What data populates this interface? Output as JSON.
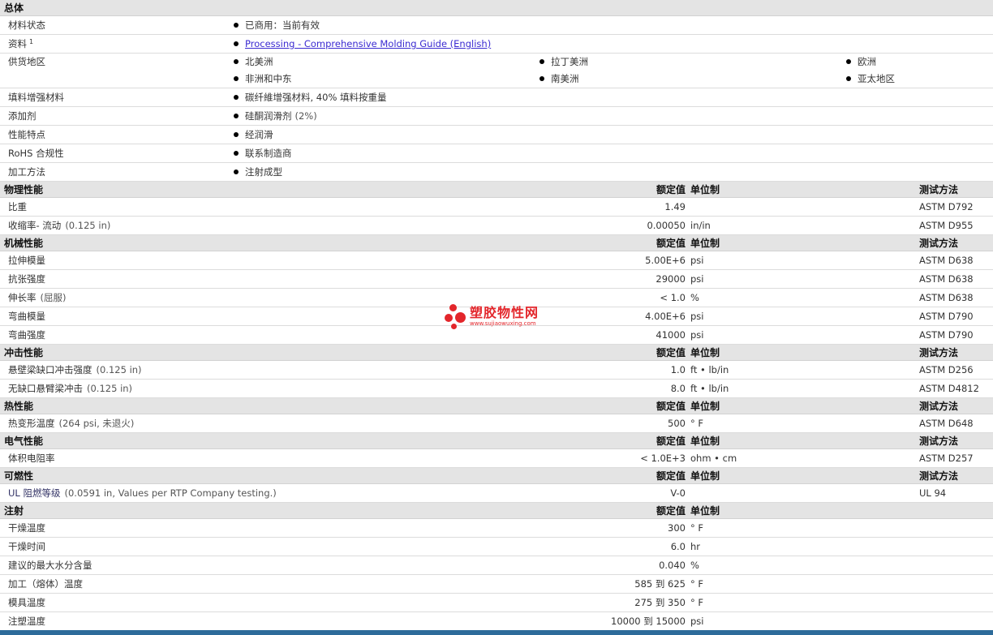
{
  "general": {
    "title": "总体",
    "rows": [
      {
        "label": "材料状态",
        "items": [
          "已商用：当前有效"
        ]
      },
      {
        "label": "资料",
        "sup": "1",
        "link": "Processing - Comprehensive Molding Guide (English)"
      },
      {
        "label": "供货地区",
        "regions": [
          [
            "北美洲",
            "拉丁美洲",
            "欧洲"
          ],
          [
            "非洲和中东",
            "南美洲",
            "亚太地区"
          ]
        ]
      },
      {
        "label": "填料增强材料",
        "items": [
          "碳纤維增强材料, 40% 填料按重量"
        ]
      },
      {
        "label": "添加剂",
        "item": "硅酮润滑剂",
        "note": "(2%)"
      },
      {
        "label": "性能特点",
        "items": [
          "经润滑"
        ]
      },
      {
        "label": "RoHS 合规性",
        "items": [
          "联系制造商"
        ]
      },
      {
        "label": "加工方法",
        "items": [
          "注射成型"
        ]
      }
    ]
  },
  "headers": {
    "value": "额定值",
    "unit": "单位制",
    "test": "测试方法"
  },
  "sections": [
    {
      "title": "物理性能",
      "rows": [
        {
          "label": "比重",
          "value": "1.49",
          "unit": "",
          "test": "ASTM D792"
        },
        {
          "label": "收缩率",
          "suffix": " - 流动",
          "note": "(0.125 in)",
          "value": "0.00050",
          "unit": "in/in",
          "test": "ASTM D955"
        }
      ]
    },
    {
      "title": "机械性能",
      "rows": [
        {
          "label": "拉伸模量",
          "value": "5.00E+6",
          "unit": "psi",
          "test": "ASTM D638"
        },
        {
          "label": "抗张强度",
          "value": "29000",
          "unit": "psi",
          "test": "ASTM D638"
        },
        {
          "label": "伸长率",
          "note": "(屈服)",
          "value": "< 1.0",
          "unit": "%",
          "test": "ASTM D638"
        },
        {
          "label": "弯曲模量",
          "value": "4.00E+6",
          "unit": "psi",
          "test": "ASTM D790"
        },
        {
          "label": "弯曲强度",
          "value": "41000",
          "unit": "psi",
          "test": "ASTM D790"
        }
      ]
    },
    {
      "title": "冲击性能",
      "rows": [
        {
          "label": "悬壁梁缺口冲击强度",
          "note": "(0.125 in)",
          "value": "1.0",
          "unit": "ft • lb/in",
          "test": "ASTM D256"
        },
        {
          "label": "无缺口悬臂梁冲击",
          "note": "(0.125 in)",
          "value": "8.0",
          "unit": "ft • lb/in",
          "test": "ASTM D4812"
        }
      ]
    },
    {
      "title": "热性能",
      "rows": [
        {
          "label": "热变形温度",
          "note": "(264 psi, 未退火)",
          "value": "500",
          "unit": "° F",
          "test": "ASTM D648"
        }
      ]
    },
    {
      "title": "电气性能",
      "rows": [
        {
          "label": "体积电阻率",
          "value": "< 1.0E+3",
          "unit": "ohm • cm",
          "test": "ASTM D257"
        }
      ]
    },
    {
      "title": "可燃性",
      "rows": [
        {
          "label": "UL 阻燃等级",
          "note": "(0.0591 in, Values per RTP Company testing.)",
          "value": "V-0",
          "unit": "",
          "test": "UL 94"
        }
      ]
    },
    {
      "title": "注射",
      "showTest": false,
      "rows": [
        {
          "label": "干燥温度",
          "value": "300",
          "unit": "° F",
          "test": ""
        },
        {
          "label": "干燥时间",
          "value": "6.0",
          "unit": "hr",
          "test": ""
        },
        {
          "label": "建议的最大水分含量",
          "value": "0.040",
          "unit": "%",
          "test": ""
        },
        {
          "label": "加工（熔体）温度",
          "value": "585 到  625",
          "unit": "° F",
          "test": ""
        },
        {
          "label": "模具温度",
          "value": "275 到  350",
          "unit": "° F",
          "test": ""
        },
        {
          "label": "注塑温度",
          "value": "10000 到  15000",
          "unit": "psi",
          "test": ""
        }
      ]
    }
  ],
  "watermark": {
    "main": "塑胶物性网",
    "sub": "www.sujiaowuxing.com"
  },
  "colors": {
    "section_bg": "#e4e4e4",
    "link": "#3a2ad1",
    "watermark": "#e3262b",
    "footer": "#2d6b9a"
  }
}
